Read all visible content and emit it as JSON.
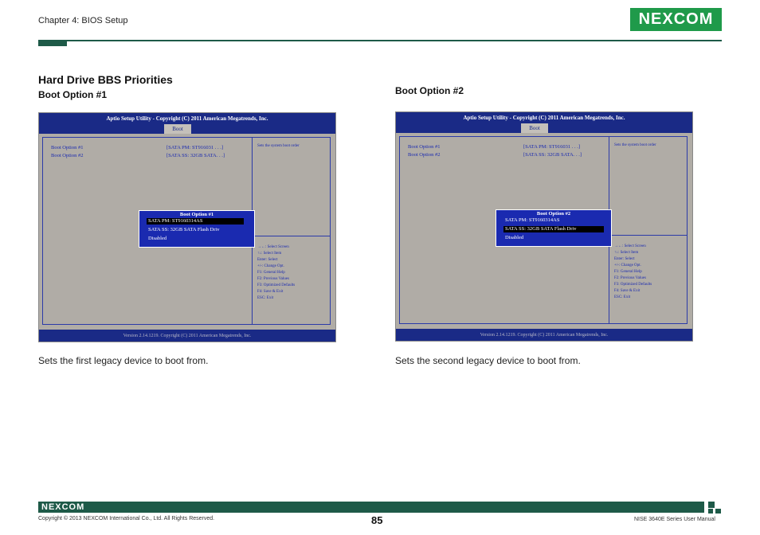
{
  "header": {
    "chapter": "Chapter 4: BIOS Setup",
    "logo_text": "NEXCOM",
    "brand_color": "#1f9a4a",
    "rule_color": "#1e5a48"
  },
  "section": {
    "title": "Hard Drive BBS Priorities"
  },
  "panels": [
    {
      "subtitle": "Boot Option #1",
      "bios": {
        "title": "Aptio Setup Utility - Copyright (C) 2011 American Megatrends, Inc.",
        "tab": "Boot",
        "rows": [
          {
            "label": "Boot Option #1",
            "value": "[SATA PM:   ST916031    . . .]"
          },
          {
            "label": "Boot Option #2",
            "value": "[SATA SS:    32GB SATA. . .]"
          }
        ],
        "help_text": "Sets the system boot order",
        "keys": [
          "→←: Select Screen",
          "↑↓: Select Item",
          "Enter: Select",
          "+/-: Change Opt.",
          "F1: General Help",
          "F2: Previous Values",
          "F3: Optimized Defaults",
          "F4: Save & Exit",
          "ESC: Exit"
        ],
        "footer": "Version 2.14.1219. Copyright (C) 2011 American Megatrends, Inc.",
        "popup": {
          "title": "Boot Option #1",
          "options": [
            "SATA PM: ST9160314AS",
            "SATA SS: 32GB SATA Flash Driv",
            "Disabled"
          ],
          "selected": 0
        }
      },
      "caption": "Sets the first legacy device to boot from."
    },
    {
      "subtitle": "Boot Option #2",
      "bios": {
        "title": "Aptio Setup Utility - Copyright (C) 2011 American Megatrends, Inc.",
        "tab": "Boot",
        "rows": [
          {
            "label": "Boot Option #1",
            "value": "[SATA PM:   ST916031    . . .]"
          },
          {
            "label": "Boot Option #2",
            "value": "[SATA SS:    32GB SATA. . .]"
          }
        ],
        "help_text": "Sets the system boot order",
        "keys": [
          "→←: Select Screen",
          "↑↓: Select Item",
          "Enter: Select",
          "+/-: Change Opt.",
          "F1: General Help",
          "F2: Previous Values",
          "F3: Optimized Defaults",
          "F4: Save & Exit",
          "ESC: Exit"
        ],
        "footer": "Version 2.14.1219. Copyright (C) 2011 American Megatrends, Inc.",
        "popup": {
          "title": "Boot Option #2",
          "options": [
            "SATA PM: ST9160314AS",
            "SATA SS: 32GB SATA Flash Driv",
            "Disabled"
          ],
          "selected": 1
        }
      },
      "caption": "Sets the second legacy device to boot from."
    }
  ],
  "footer": {
    "logo_text": "NEXCOM",
    "copyright": "Copyright © 2013 NEXCOM International Co., Ltd. All Rights Reserved.",
    "page_number": "85",
    "manual": "NISE 3640E Series User Manual"
  }
}
